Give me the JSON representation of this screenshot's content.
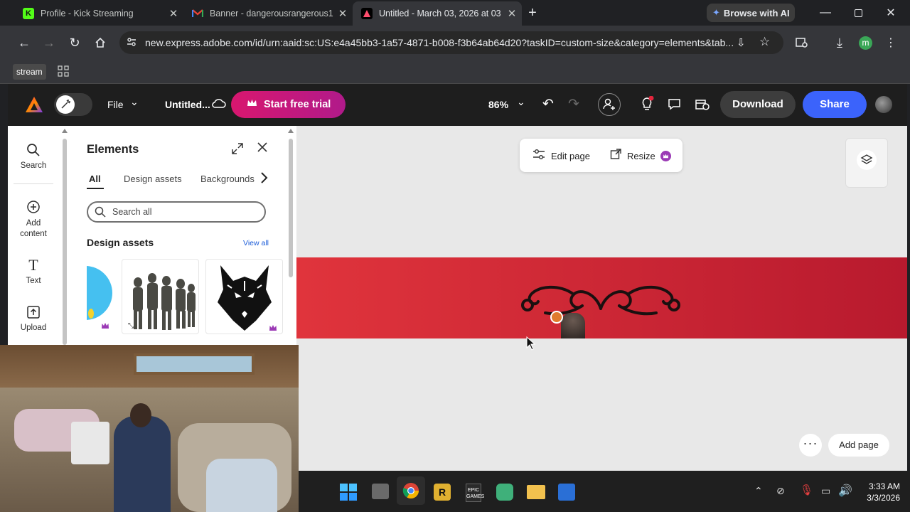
{
  "browser": {
    "tabs": [
      {
        "title": "Profile - Kick Streaming",
        "icon": "kick-icon"
      },
      {
        "title": "Banner - dangerousrangerous1",
        "icon": "gmail-icon"
      },
      {
        "title": "Untitled - March 03, 2026 at 03",
        "icon": "adobe-express-icon",
        "active": true
      }
    ],
    "browse_ai": "Browse with AI",
    "url": "new.express.adobe.com/id/urn:aaid:sc:US:e4a45bb3-1a57-4871-b008-f3b64ab64d20?taskID=custom-size&category=elements&tab...",
    "profile_initial": "m",
    "bookmark_label": "stream"
  },
  "header": {
    "file_label": "File",
    "doc_title": "Untitled...",
    "trial_label": "Start free trial",
    "zoom": "86%",
    "download_label": "Download",
    "share_label": "Share"
  },
  "rail": {
    "search": "Search",
    "add_content": "Add content",
    "text": "Text",
    "upload": "Upload"
  },
  "panel": {
    "title": "Elements",
    "tabs": [
      "All",
      "Design assets",
      "Backgrounds"
    ],
    "search_placeholder": "Search all",
    "section_title": "Design assets",
    "view_all": "View all"
  },
  "canvas": {
    "edit_page": "Edit page",
    "resize": "Resize",
    "add_page": "Add page",
    "banner_color_start": "#e0343c",
    "banner_color_end": "#b81a2e"
  },
  "taskbar": {
    "time": "3:33 AM",
    "date": "3/3/2026"
  }
}
